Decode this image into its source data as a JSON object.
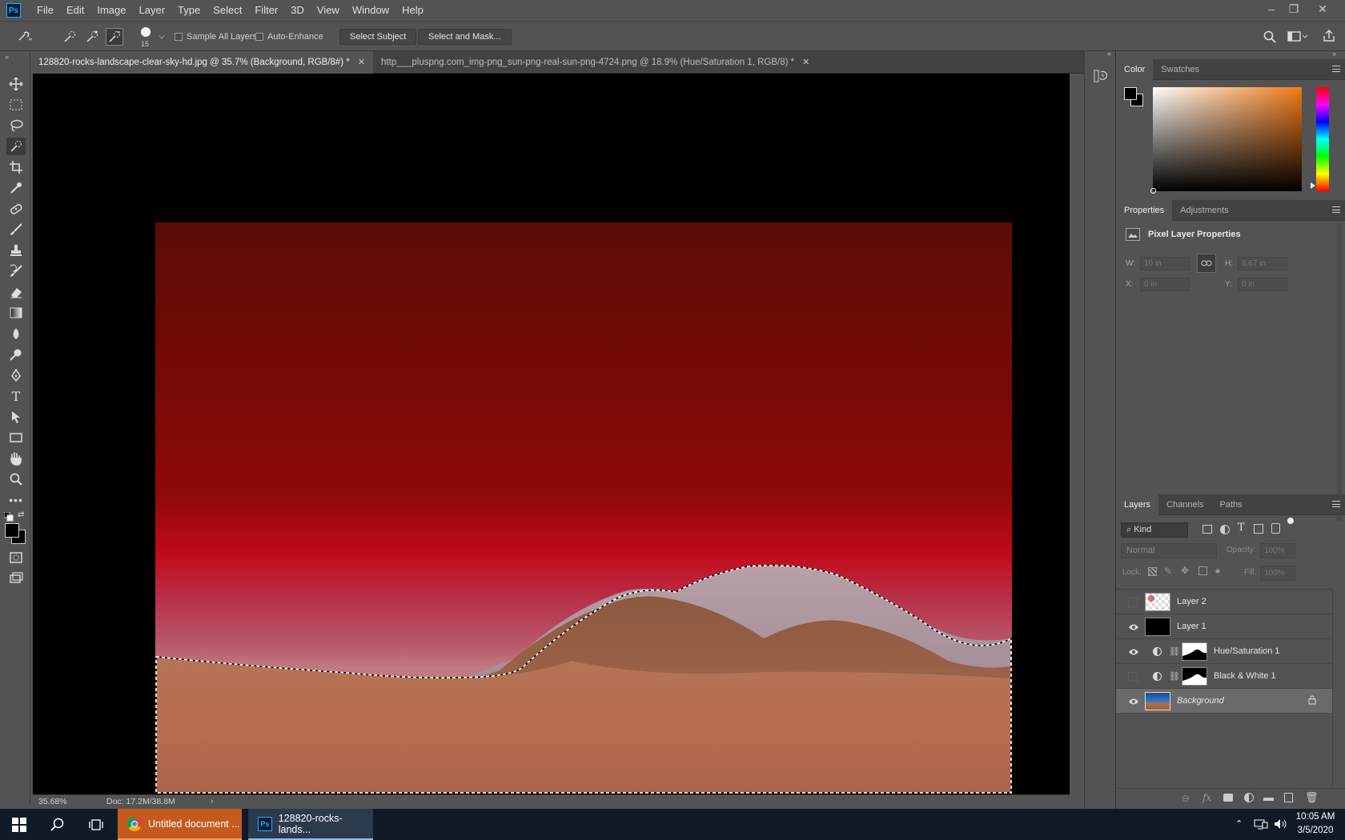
{
  "menubar": {
    "logo": "Ps",
    "items": [
      "File",
      "Edit",
      "Image",
      "Layer",
      "Type",
      "Select",
      "Filter",
      "3D",
      "View",
      "Window",
      "Help"
    ]
  },
  "options": {
    "brush_size": "15",
    "sample_all_layers": "Sample All Layers",
    "auto_enhance": "Auto-Enhance",
    "select_subject": "Select Subject",
    "select_and_mask": "Select and Mask..."
  },
  "tabs": [
    {
      "label": "128820-rocks-landscape-clear-sky-hd.jpg @ 35.7% (Background, RGB/8#) *",
      "active": true
    },
    {
      "label": "http___pluspng.com_img-png_sun-png-real-sun-png-4724.png @ 18.9% (Hue/Saturation 1, RGB/8) *",
      "active": false
    }
  ],
  "status": {
    "zoom": "35.68%",
    "doc": "Doc: 17.2M/38.8M",
    "arrow": "›"
  },
  "color_panel": {
    "tabs": [
      "Color",
      "Swatches"
    ]
  },
  "properties_panel": {
    "tabs": [
      "Properties",
      "Adjustments"
    ],
    "title": "Pixel Layer Properties",
    "w_label": "W:",
    "w_value": "10 in",
    "h_label": "H:",
    "h_value": "6.67 in",
    "x_label": "X:",
    "x_value": "0 in",
    "y_label": "Y:",
    "y_value": "0 in"
  },
  "layers_panel": {
    "tabs": [
      "Layers",
      "Channels",
      "Paths"
    ],
    "filter_kind": "Kind",
    "blend_mode": "Normal",
    "opacity_label": "Opacity:",
    "opacity_value": "100%",
    "lock_label": "Lock:",
    "fill_label": "Fill:",
    "fill_value": "100%",
    "layers": [
      {
        "name": "Layer 2",
        "visible": false
      },
      {
        "name": "Layer 1",
        "visible": true
      },
      {
        "name": "Hue/Saturation 1",
        "visible": true
      },
      {
        "name": "Black & White 1",
        "visible": false
      },
      {
        "name": "Background",
        "visible": true
      }
    ]
  },
  "taskbar": {
    "apps": [
      {
        "label": "Untitled document ..."
      },
      {
        "label": "128820-rocks-lands..."
      }
    ],
    "time": "10:05 AM",
    "date": "3/5/2020"
  },
  "colors": {
    "accent": "#31a8ff",
    "chrome_task": "#c65a1e",
    "selected_layer": "#6a6a6a"
  }
}
